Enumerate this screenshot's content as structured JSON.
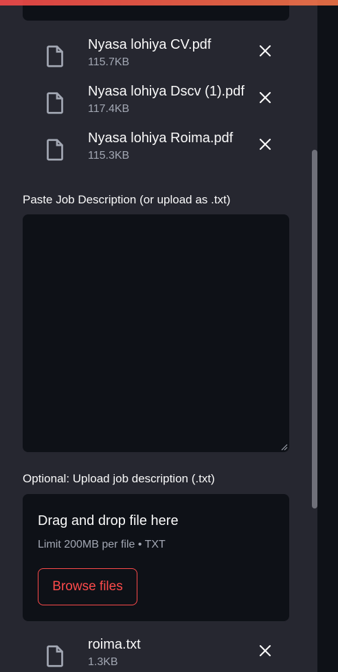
{
  "colors": {
    "sidebar_bg": "#262730",
    "widget_bg": "#0e1117",
    "accent": "#ff4b4b",
    "muted_text": "#a3a8b4"
  },
  "resume_files": [
    {
      "name": "Nyasa lohiya CV.pdf",
      "size": "115.7KB",
      "icon": "file-icon",
      "remove_icon": "close-icon"
    },
    {
      "name": "Nyasa lohiya Dscv (1).pdf",
      "size": "117.4KB",
      "icon": "file-icon",
      "remove_icon": "close-icon"
    },
    {
      "name": "Nyasa lohiya Roima.pdf",
      "size": "115.3KB",
      "icon": "file-icon",
      "remove_icon": "close-icon"
    }
  ],
  "job_description": {
    "label": "Paste Job Description (or upload as .txt)",
    "value": ""
  },
  "jd_upload": {
    "label": "Optional: Upload job description (.txt)",
    "dropzone_title": "Drag and drop file here",
    "dropzone_limit": "Limit 200MB per file • TXT",
    "browse_label": "Browse files"
  },
  "jd_files": [
    {
      "name": "roima.txt",
      "size": "1.3KB",
      "icon": "file-icon",
      "remove_icon": "close-icon"
    }
  ]
}
